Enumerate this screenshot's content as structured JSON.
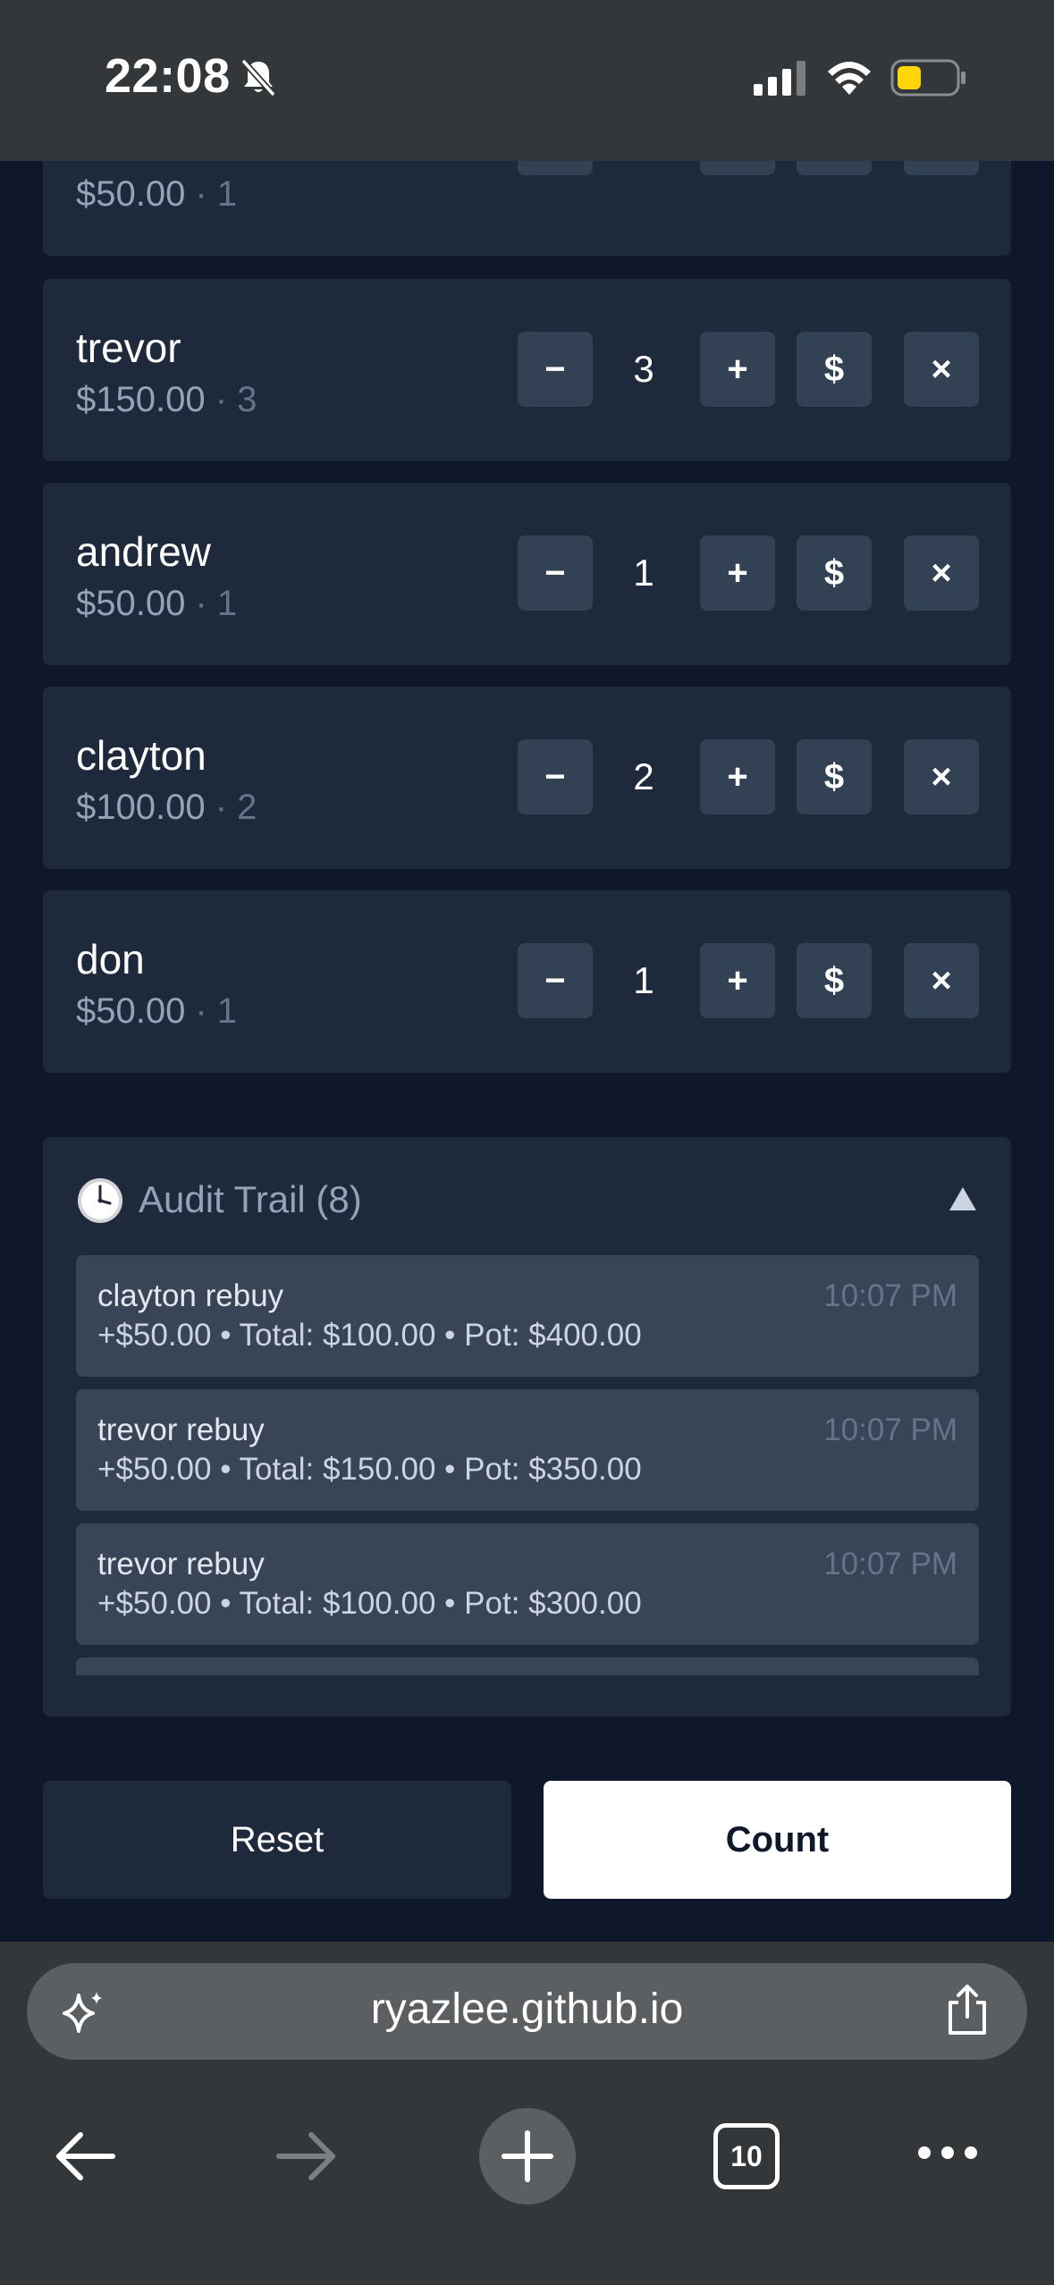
{
  "status_bar": {
    "time": "22:08",
    "icons": [
      "bell-slash-icon",
      "cellular-signal-icon",
      "wifi-icon",
      "battery-low-power-icon"
    ],
    "battery_color": "#ffd60a"
  },
  "players": [
    {
      "name": "",
      "amount": "$50.00",
      "count_suffix": "1",
      "count": "1"
    },
    {
      "name": "trevor",
      "amount": "$150.00",
      "count_suffix": "3",
      "count": "3"
    },
    {
      "name": "andrew",
      "amount": "$50.00",
      "count_suffix": "1",
      "count": "1"
    },
    {
      "name": "clayton",
      "amount": "$100.00",
      "count_suffix": "2",
      "count": "2"
    },
    {
      "name": "don",
      "amount": "$50.00",
      "count_suffix": "1",
      "count": "1"
    }
  ],
  "player_controls": {
    "minus_label": "−",
    "plus_label": "+",
    "cash_label": "$",
    "remove_label": "×",
    "separator": " · "
  },
  "audit": {
    "title": "Audit Trail (8)",
    "entries": [
      {
        "title": "clayton rebuy",
        "detail": "+$50.00 • Total: $100.00 • Pot: $400.00",
        "time": "10:07 PM"
      },
      {
        "title": "trevor rebuy",
        "detail": "+$50.00 • Total: $150.00 • Pot: $350.00",
        "time": "10:07 PM"
      },
      {
        "title": "trevor rebuy",
        "detail": "+$50.00 • Total: $100.00 • Pot: $300.00",
        "time": "10:07 PM"
      },
      {
        "title": "",
        "detail": "",
        "time": ""
      }
    ]
  },
  "actions": {
    "reset_label": "Reset",
    "count_label": "Count"
  },
  "browser": {
    "url": "ryazlee.github.io",
    "tab_count": "10"
  },
  "colors": {
    "page_background": "#0f172a",
    "card_background": "#1e293b",
    "button_background": "#334155",
    "audit_entry_background": "#3a4457",
    "muted_text": "#94a3b8",
    "primary_button": "#ffffff"
  }
}
